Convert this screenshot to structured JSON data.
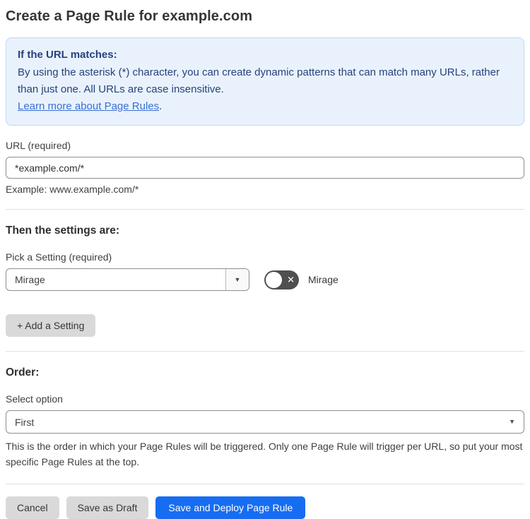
{
  "page": {
    "title": "Create a Page Rule for example.com"
  },
  "info_box": {
    "heading": "If the URL matches:",
    "body": "By using the asterisk (*) character, you can create dynamic patterns that can match many URLs, rather than just one. All URLs are case insensitive.",
    "link_label": "Learn more about Page Rules",
    "link_suffix": "."
  },
  "url_field": {
    "label": "URL (required)",
    "value": "*example.com/*",
    "hint": "Example: www.example.com/*"
  },
  "settings": {
    "heading": "Then the settings are:",
    "picker_label": "Pick a Setting (required)",
    "selected_setting": "Mirage",
    "toggle_state": "off",
    "toggle_icon": "✕",
    "toggle_label": "Mirage",
    "add_setting_button": "+ Add a Setting",
    "caret": "▼"
  },
  "order": {
    "heading": "Order:",
    "label": "Select option",
    "selected_option": "First",
    "caret": "▼",
    "help_text": "This is the order in which your Page Rules will be triggered. Only one Page Rule will trigger per URL, so put your most specific Page Rules at the top."
  },
  "footer": {
    "cancel_label": "Cancel",
    "save_draft_label": "Save as Draft",
    "save_deploy_label": "Save and Deploy Page Rule"
  },
  "colors": {
    "info_bg": "#e9f2fc",
    "info_border": "#bcd9f1",
    "info_text": "#27417d",
    "link": "#3a6fd3",
    "primary_button": "#176df2",
    "toggle_off_bg": "#4f4f4f",
    "gray_button": "#d9d9d9"
  }
}
